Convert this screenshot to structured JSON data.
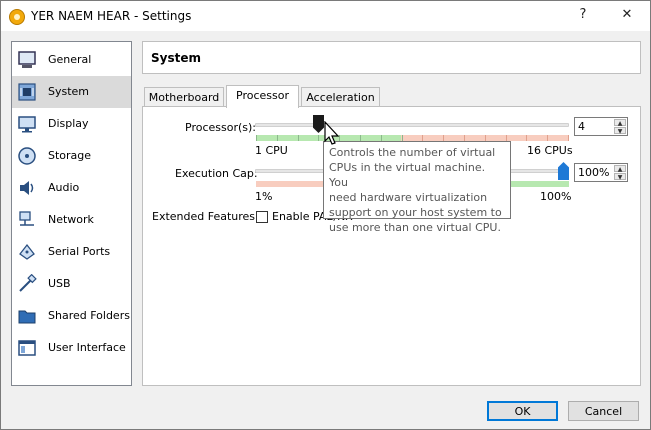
{
  "window": {
    "title": "YER NAEM HEAR - Settings",
    "help_label": "?",
    "close_label": "✕"
  },
  "sidebar": {
    "items": [
      {
        "label": "General",
        "icon": "general-icon"
      },
      {
        "label": "System",
        "icon": "system-icon",
        "selected": true
      },
      {
        "label": "Display",
        "icon": "display-icon"
      },
      {
        "label": "Storage",
        "icon": "storage-icon"
      },
      {
        "label": "Audio",
        "icon": "audio-icon"
      },
      {
        "label": "Network",
        "icon": "network-icon"
      },
      {
        "label": "Serial Ports",
        "icon": "serial-ports-icon"
      },
      {
        "label": "USB",
        "icon": "usb-icon"
      },
      {
        "label": "Shared Folders",
        "icon": "shared-folders-icon"
      },
      {
        "label": "User Interface",
        "icon": "user-interface-icon"
      }
    ]
  },
  "section": {
    "title": "System"
  },
  "tabs": [
    {
      "label": "Motherboard",
      "active": false
    },
    {
      "label": "Processor",
      "active": true
    },
    {
      "label": "Acceleration",
      "active": false
    }
  ],
  "processor": {
    "label": "Processor(s):",
    "value": "4",
    "min_label": "1 CPU",
    "max_label": "16 CPUs",
    "min": 1,
    "max": 16,
    "current": 4
  },
  "exec_cap": {
    "label": "Execution Cap:",
    "value": "100%",
    "min_label": "1%",
    "max_label": "100%",
    "current_percent": 100
  },
  "extended": {
    "label": "Extended Features:",
    "checkbox_label": "Enable PAE/NX",
    "checked": false
  },
  "tooltip": {
    "text": "Controls the number of virtual\nCPUs in the virtual machine. You\nneed hardware virtualization\nsupport on your host system to\nuse more than one virtual CPU."
  },
  "buttons": {
    "ok": "OK",
    "cancel": "Cancel"
  },
  "colors": {
    "green_zone": "#b7e8b0",
    "red_zone": "#f8cdbf",
    "selected_bg": "#dadada",
    "accent_blue": "#1e79d6",
    "primary_border": "#0078d7"
  }
}
